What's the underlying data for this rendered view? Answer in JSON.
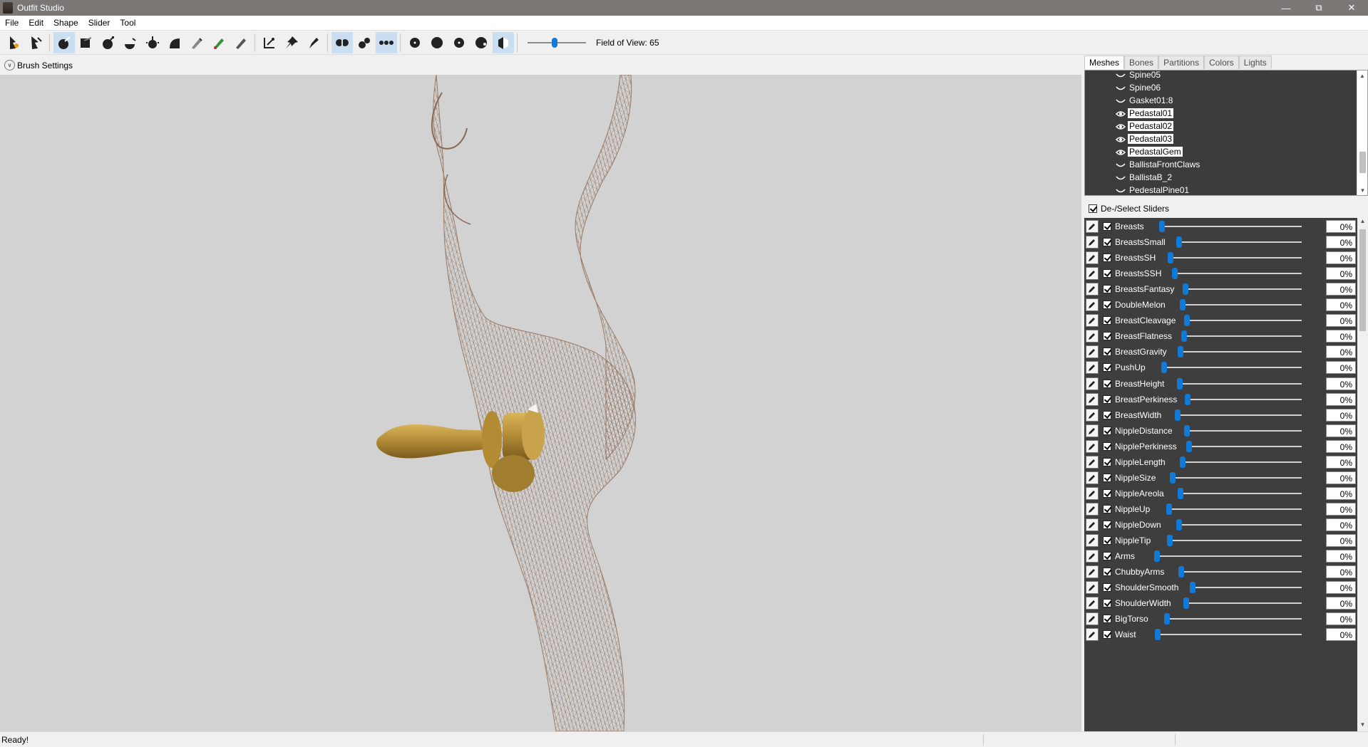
{
  "window": {
    "title": "Outfit Studio",
    "minimize": "—",
    "maximize": "⧉",
    "close": "✕"
  },
  "menu": [
    "File",
    "Edit",
    "Shape",
    "Slider",
    "Tool"
  ],
  "toolbar": {
    "fov_label": "Field of View: 65",
    "fov_value": 65,
    "tools": [
      {
        "name": "select-tool-icon",
        "active": false
      },
      {
        "name": "transform-tool-icon",
        "active": false
      },
      {
        "name": "standard-brush-icon",
        "active": true
      },
      {
        "name": "mask-brush-icon",
        "active": false
      },
      {
        "name": "inflate-brush-icon",
        "active": false
      },
      {
        "name": "deflate-brush-icon",
        "active": false
      },
      {
        "name": "move-brush-icon",
        "active": false
      },
      {
        "name": "smooth-brush-icon",
        "active": false
      },
      {
        "name": "weight-brush-icon",
        "active": false
      },
      {
        "name": "color-brush-icon",
        "active": false
      },
      {
        "name": "alpha-brush-icon",
        "active": false
      },
      {
        "name": "collapse-vertex-icon",
        "active": false
      },
      {
        "name": "pin-icon",
        "active": false
      },
      {
        "name": "pen-icon",
        "active": false
      },
      {
        "name": "x-mirror-icon",
        "active": true
      },
      {
        "name": "connected-only-icon",
        "active": false
      },
      {
        "name": "global-brush-icon",
        "active": true
      },
      {
        "name": "brush-size-1-icon",
        "active": false
      },
      {
        "name": "brush-size-2-icon",
        "active": false
      },
      {
        "name": "brush-size-3-icon",
        "active": false
      },
      {
        "name": "brush-size-4-icon",
        "active": false
      },
      {
        "name": "shading-toggle-icon",
        "active": true
      }
    ]
  },
  "brush_settings": {
    "label": "Brush Settings"
  },
  "tabs": [
    {
      "label": "Meshes",
      "active": true
    },
    {
      "label": "Bones",
      "active": false
    },
    {
      "label": "Partitions",
      "active": false
    },
    {
      "label": "Colors",
      "active": false
    },
    {
      "label": "Lights",
      "active": false
    }
  ],
  "meshes": [
    {
      "name": "Spine05",
      "visible": false,
      "selected": false
    },
    {
      "name": "Spine06",
      "visible": false,
      "selected": false
    },
    {
      "name": "Gasket01:8",
      "visible": false,
      "selected": false
    },
    {
      "name": "Pedastal01",
      "visible": true,
      "selected": true
    },
    {
      "name": "Pedastal02",
      "visible": true,
      "selected": true
    },
    {
      "name": "Pedastal03",
      "visible": true,
      "selected": true
    },
    {
      "name": "PedastalGem",
      "visible": true,
      "selected": true
    },
    {
      "name": "BallistaFrontClaws",
      "visible": false,
      "selected": false
    },
    {
      "name": "BallistaB_2",
      "visible": false,
      "selected": false
    },
    {
      "name": "PedestalPine01",
      "visible": false,
      "selected": false
    }
  ],
  "sliders_header": "De-/Select Sliders",
  "sliders": [
    {
      "name": "Breasts",
      "value": "0%"
    },
    {
      "name": "BreastsSmall",
      "value": "0%"
    },
    {
      "name": "BreastsSH",
      "value": "0%"
    },
    {
      "name": "BreastsSSH",
      "value": "0%"
    },
    {
      "name": "BreastsFantasy",
      "value": "0%"
    },
    {
      "name": "DoubleMelon",
      "value": "0%"
    },
    {
      "name": "BreastCleavage",
      "value": "0%"
    },
    {
      "name": "BreastFlatness",
      "value": "0%"
    },
    {
      "name": "BreastGravity",
      "value": "0%"
    },
    {
      "name": "PushUp",
      "value": "0%"
    },
    {
      "name": "BreastHeight",
      "value": "0%"
    },
    {
      "name": "BreastPerkiness",
      "value": "0%"
    },
    {
      "name": "BreastWidth",
      "value": "0%"
    },
    {
      "name": "NippleDistance",
      "value": "0%"
    },
    {
      "name": "NipplePerkiness",
      "value": "0%"
    },
    {
      "name": "NippleLength",
      "value": "0%"
    },
    {
      "name": "NippleSize",
      "value": "0%"
    },
    {
      "name": "NippleAreola",
      "value": "0%"
    },
    {
      "name": "NippleUp",
      "value": "0%"
    },
    {
      "name": "NippleDown",
      "value": "0%"
    },
    {
      "name": "NippleTip",
      "value": "0%"
    },
    {
      "name": "Arms",
      "value": "0%"
    },
    {
      "name": "ChubbyArms",
      "value": "0%"
    },
    {
      "name": "ShoulderSmooth",
      "value": "0%"
    },
    {
      "name": "ShoulderWidth",
      "value": "0%"
    },
    {
      "name": "BigTorso",
      "value": "0%"
    },
    {
      "name": "Waist",
      "value": "0%"
    }
  ],
  "status": {
    "text": "Ready!"
  }
}
